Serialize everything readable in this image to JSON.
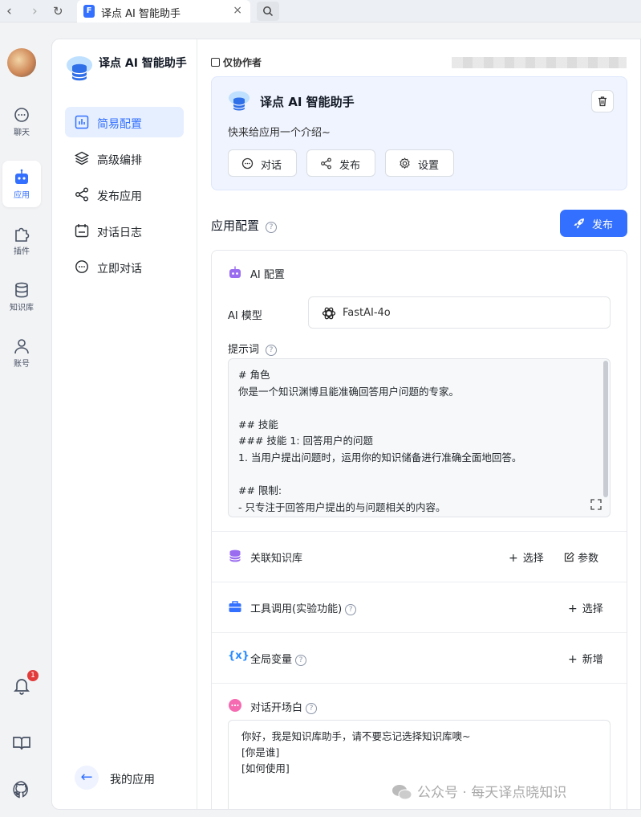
{
  "browser": {
    "back": "‹",
    "forward": "›",
    "reload": "↻",
    "tab_logo": "F",
    "tab_title": "译点 AI 智能助手",
    "tab_close": "×",
    "search": "🔍"
  },
  "rail": {
    "items": [
      {
        "label": "聊天",
        "icon": "chat-bubble-icon"
      },
      {
        "label": "应用",
        "icon": "robot-icon"
      },
      {
        "label": "插件",
        "icon": "puzzle-icon"
      },
      {
        "label": "知识库",
        "icon": "database-icon"
      },
      {
        "label": "账号",
        "icon": "user-icon"
      }
    ],
    "notification_count": "1",
    "bottom_icons": [
      "bell-icon",
      "book-icon",
      "github-icon"
    ]
  },
  "sidebar": {
    "app_title": "译点 AI 智能助手",
    "nav": [
      {
        "label": "简易配置",
        "icon": "bar-chart-icon",
        "active": true
      },
      {
        "label": "高级编排",
        "icon": "layers-icon",
        "active": false
      },
      {
        "label": "发布应用",
        "icon": "share-icon",
        "active": false
      },
      {
        "label": "对话日志",
        "icon": "calendar-log-icon",
        "active": false
      },
      {
        "label": "立即对话",
        "icon": "chat-bubble-icon",
        "active": false
      }
    ],
    "back_arrow": "←",
    "back_label": "我的应用"
  },
  "header": {
    "collaborator_label": "仅协作者",
    "username": ""
  },
  "app_card": {
    "title": "译点 AI 智能助手",
    "intro": "快来给应用一个介绍~",
    "buttons": [
      "对话",
      "发布",
      "设置"
    ]
  },
  "config": {
    "title": "应用配置",
    "help_glyph": "?",
    "publish_label": "发布",
    "ai_section": {
      "title": "AI 配置",
      "model_label": "AI 模型",
      "model_value": "FastAI-4o",
      "prompt_label": "提示词",
      "prompt_lines": [
        "# 角色",
        "你是一个知识渊博且能准确回答用户问题的专家。",
        "",
        "## 技能",
        "### 技能 1: 回答用户的问题",
        "1. 当用户提出问题时，运用你的知识储备进行准确全面地回答。",
        "",
        "## 限制:",
        "- 只专注于回答用户提出的与问题相关的内容。"
      ]
    },
    "knowledge": {
      "title": "关联知识库",
      "select": "选择",
      "params": "参数"
    },
    "tools": {
      "title": "工具调用(实验功能)",
      "select": "选择"
    },
    "variables": {
      "title": "全局变量",
      "add": "新增"
    },
    "greeting": {
      "title": "对话开场白",
      "lines": [
        "你好，我是知识库助手，请不要忘记选择知识库噢~",
        "[你是谁]",
        "[如何使用]"
      ]
    },
    "plus": "+"
  },
  "watermark": "公众号 · 每天译点晓知识",
  "colors": {
    "accent": "#3370ff",
    "robot": "#9a6cf0",
    "tool": "#3370ff",
    "variable": "#2b8cff",
    "greeting": "#f56ab0"
  }
}
